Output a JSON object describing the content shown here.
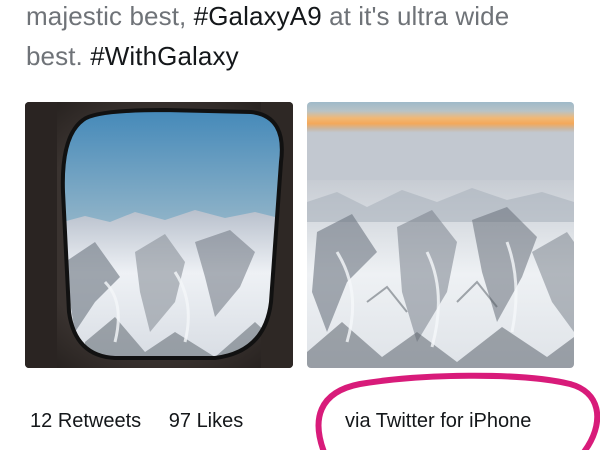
{
  "tweet": {
    "line1_prefix": "majestic best, ",
    "hashtag1": "#GalaxyA9",
    "line1_suffix": " at it's ultra wide",
    "line2_prefix": "best. ",
    "hashtag2": "#WithGalaxy"
  },
  "stats": {
    "retweets_count": "12",
    "retweets_label": "Retweets",
    "likes_count": "97",
    "likes_label": "Likes"
  },
  "source": {
    "label": "via Twitter for iPhone"
  },
  "colors": {
    "annotation": "#d81b7a",
    "body_text": "#6f7378",
    "hashtag_text": "#14171a"
  }
}
